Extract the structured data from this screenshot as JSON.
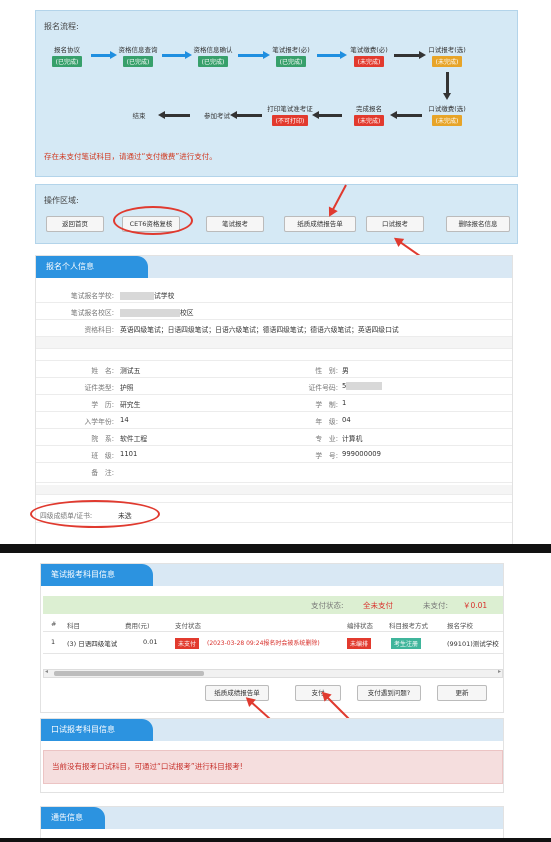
{
  "flow": {
    "title": "报名流程:",
    "steps": [
      {
        "name": "报名协议",
        "status": "(已完成)"
      },
      {
        "name": "资格信息查询",
        "status": "(已完成)"
      },
      {
        "name": "资格信息确认",
        "status": "(已完成)"
      },
      {
        "name": "笔试报考(必)",
        "status": "(已完成)"
      },
      {
        "name": "笔试缴费(必)",
        "status": "(未完成)"
      },
      {
        "name": "口试报考(选)",
        "status": "(未完成)"
      },
      {
        "name": "口试缴费(选)",
        "status": "(未完成)"
      },
      {
        "name": "完成报名",
        "status": "(未完成)"
      },
      {
        "name": "打印笔试准考证",
        "status": "(不可打印)"
      },
      {
        "name": "参加考试",
        "status": ""
      },
      {
        "name": "结束",
        "status": ""
      }
    ],
    "warning": "存在未支付笔试科目，请通过“支付缴费”进行支付。",
    "colors": {
      "done": "#37a06b",
      "undone": "#e23a2e",
      "optional": "#e7a428",
      "flow_arrow": "#1f8fe0"
    }
  },
  "ops": {
    "title": "操作区域:",
    "buttons": [
      "返回首页",
      "CET6资格复核",
      "笔试报考",
      "纸质成绩报告单",
      "口试报考",
      "删除报名信息"
    ]
  },
  "personal": {
    "tab": "报名个人信息",
    "school_label": "笔试报名学校:",
    "school_value": "试学校",
    "campus_label": "笔试报名校区:",
    "campus_value": "校区",
    "subjects_label": "资格科目:",
    "subjects_value": "英语四级笔试；日语四级笔试；日语六级笔试；德语四级笔试；德语六级笔试；英语四级口试",
    "name_label": "姓　名:",
    "name_value": "测试五",
    "gender_label": "性　别:",
    "gender_value": "男",
    "idtype_label": "证件类型:",
    "idtype_value": "护照",
    "idno_label": "证件号码:",
    "idno_value": "5",
    "edu_label": "学　历:",
    "edu_value": "研究生",
    "system_label": "学　制:",
    "system_value": "1",
    "year_label": "入学年份:",
    "year_value": "14",
    "grade_label": "年　级:",
    "grade_value": "04",
    "dept_label": "院　系:",
    "dept_value": "软件工程",
    "major_label": "专　业:",
    "major_value": "计算机",
    "class_label": "班　级:",
    "class_value": "1101",
    "stuno_label": "学　号:",
    "stuno_value": "999000009",
    "note_label": "备　注:",
    "cert_label": "四级成绩单/证书:",
    "cert_value": "未选"
  },
  "payment": {
    "tab": "笔试报考科目信息",
    "status_label": "支付状态:",
    "status_value": "全未支付",
    "unpaid_label": "未支付:",
    "unpaid_value": "￥0.01",
    "headers": [
      "#",
      "科目",
      "费用(元)",
      "支付状态",
      "编排状态",
      "科目报考方式",
      "报名学校"
    ],
    "row": {
      "index": "1",
      "subject": "(3) 日语四级笔试",
      "fee": "0.01",
      "pay_badge": "未支付",
      "pay_note": "(2023-03-28 09:24报名时会被系统删除)",
      "arrange_badge": "未编排",
      "mode_badge": "考生注册",
      "school": "(99101)测试学校"
    },
    "buttons": [
      "纸质成绩报告单",
      "支付",
      "支付遇到问题?",
      "更新"
    ]
  },
  "oral": {
    "tab": "口试报考科目信息",
    "warning": "当前没有报考口试科目，可通过“口试报考”进行科目报考!"
  },
  "notice": {
    "tab": "通告信息"
  }
}
